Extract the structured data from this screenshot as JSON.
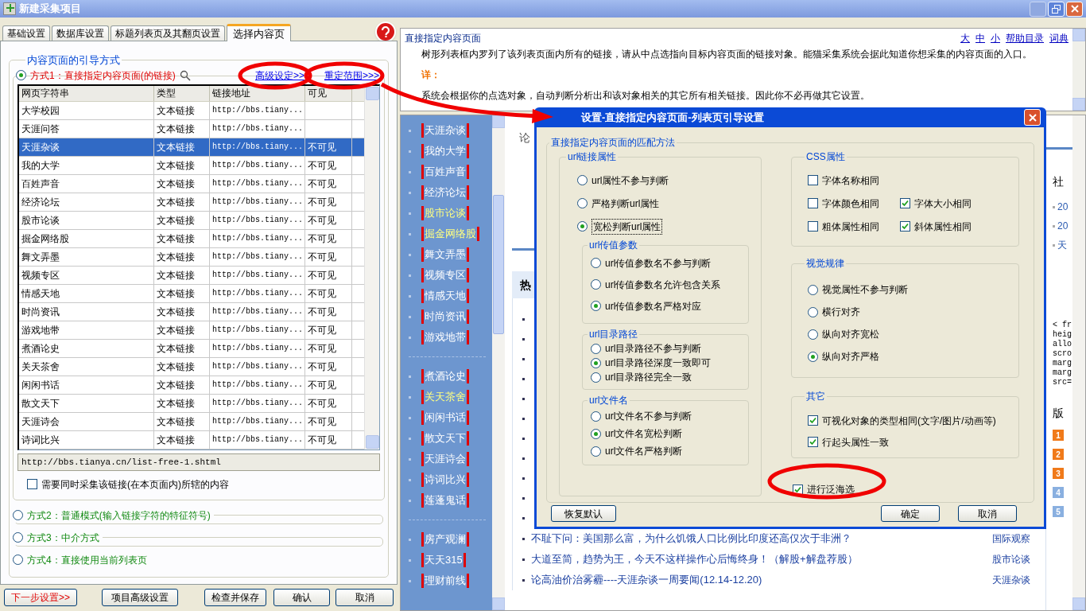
{
  "window": {
    "title": "新建采集项目"
  },
  "tabs": [
    {
      "label": "基础设置",
      "selected": false
    },
    {
      "label": "数据库设置",
      "selected": false
    },
    {
      "label": "标题列表页及其翻页设置",
      "selected": false
    },
    {
      "label": "选择内容页",
      "selected": true
    }
  ],
  "guide_group": {
    "title": "内容页面的引导方式",
    "links": [
      "高级设定>>",
      "重定范围>>>"
    ],
    "methods": [
      {
        "label": "方式1：直接指定内容页面(的链接)",
        "selected": true
      },
      {
        "label": "方式2：普通模式(输入链接字符的特征符号)",
        "selected": false
      },
      {
        "label": "方式3：中介方式",
        "selected": false
      },
      {
        "label": "方式4：直接使用当前列表页",
        "selected": false
      }
    ]
  },
  "table": {
    "columns": [
      "网页字符串",
      "类型",
      "链接地址",
      "可见"
    ],
    "rows": [
      {
        "text": "大学校园",
        "type": "文本链接",
        "url": "http://bbs.tiany...",
        "selected": false
      },
      {
        "text": "天涯问答",
        "type": "文本链接",
        "url": "http://bbs.tiany...",
        "selected": false
      },
      {
        "text": "天涯杂谈",
        "type": "文本链接",
        "url": "http://bbs.tiany...",
        "visible": "不可见",
        "selected": true
      },
      {
        "text": "我的大学",
        "type": "文本链接",
        "url": "http://bbs.tiany...",
        "visible": "不可见",
        "selected": false
      },
      {
        "text": "百姓声音",
        "type": "文本链接",
        "url": "http://bbs.tiany...",
        "visible": "不可见",
        "selected": false
      },
      {
        "text": "经济论坛",
        "type": "文本链接",
        "url": "http://bbs.tiany...",
        "visible": "不可见",
        "selected": false
      },
      {
        "text": "股市论谈",
        "type": "文本链接",
        "url": "http://bbs.tiany...",
        "visible": "不可见",
        "selected": false
      },
      {
        "text": "掘金网络股",
        "type": "文本链接",
        "url": "http://bbs.tiany...",
        "visible": "不可见",
        "selected": false
      },
      {
        "text": "舞文弄墨",
        "type": "文本链接",
        "url": "http://bbs.tiany...",
        "visible": "不可见",
        "selected": false
      },
      {
        "text": "视频专区",
        "type": "文本链接",
        "url": "http://bbs.tiany...",
        "visible": "不可见",
        "selected": false
      },
      {
        "text": "情感天地",
        "type": "文本链接",
        "url": "http://bbs.tiany...",
        "visible": "不可见",
        "selected": false
      },
      {
        "text": "时尚资讯",
        "type": "文本链接",
        "url": "http://bbs.tiany...",
        "visible": "不可见",
        "selected": false
      },
      {
        "text": "游戏地带",
        "type": "文本链接",
        "url": "http://bbs.tiany...",
        "visible": "不可见",
        "selected": false
      },
      {
        "text": "煮酒论史",
        "type": "文本链接",
        "url": "http://bbs.tiany...",
        "visible": "不可见",
        "selected": false
      },
      {
        "text": "关天茶舍",
        "type": "文本链接",
        "url": "http://bbs.tiany...",
        "visible": "不可见",
        "selected": false
      },
      {
        "text": "闲闲书话",
        "type": "文本链接",
        "url": "http://bbs.tiany...",
        "visible": "不可见",
        "selected": false
      },
      {
        "text": "散文天下",
        "type": "文本链接",
        "url": "http://bbs.tiany...",
        "visible": "不可见",
        "selected": false
      },
      {
        "text": "天涯诗会",
        "type": "文本链接",
        "url": "http://bbs.tiany...",
        "visible": "不可见",
        "selected": false
      },
      {
        "text": "诗词比兴",
        "type": "文本链接",
        "url": "http://bbs.tiany...",
        "visible": "不可见",
        "selected": false
      }
    ]
  },
  "url_field": {
    "value": "http://bbs.tianya.cn/list-free-1.shtml"
  },
  "collect_sub_content": {
    "label": "需要同时采集该链接(在本页面内)所辖的内容",
    "checked": false
  },
  "bottom_buttons": [
    {
      "label": "下一步设置>>",
      "kind": "next"
    },
    {
      "label": "项目高级设置",
      "kind": "normal"
    },
    {
      "label": "检查并保存",
      "kind": "normal"
    },
    {
      "label": "确认",
      "kind": "normal"
    },
    {
      "label": "取消",
      "kind": "normal"
    }
  ],
  "help": {
    "title": "直接指定内容页面",
    "links": [
      "大",
      "中",
      "小",
      "帮助目录",
      "词典"
    ],
    "paragraphs": [
      {
        "kind": "body",
        "text": "树形列表框内罗列了该列表页面内所有的链接，请从中点选指向目标内容页面的链接对象。能猫采集系统会据此知道你想采集的内容页面的入口。"
      },
      {
        "kind": "heading",
        "text": "详："
      },
      {
        "kind": "body",
        "text": "系统会根据你的点选对象，自动判断分析出和该对象相关的其它所有相关链接。因此你不必再做其它设置。"
      }
    ]
  },
  "browser": {
    "sidebar_groups": [
      {
        "items": [
          {
            "label": "天涯杂谈",
            "highlighted": false
          },
          {
            "label": "我的大学",
            "highlighted": false
          },
          {
            "label": "百姓声音",
            "highlighted": false
          },
          {
            "label": "经济论坛",
            "highlighted": false
          },
          {
            "label": "股市论谈",
            "highlighted": true
          },
          {
            "label": "掘金网络股",
            "highlighted": true
          },
          {
            "label": "舞文弄墨",
            "highlighted": false
          },
          {
            "label": "视频专区",
            "highlighted": false
          },
          {
            "label": "情感天地",
            "highlighted": false
          },
          {
            "label": "时尚资讯",
            "highlighted": false
          },
          {
            "label": "游戏地带",
            "highlighted": false
          }
        ]
      },
      {
        "items": [
          {
            "label": "煮酒论史",
            "highlighted": false
          },
          {
            "label": "关天茶舍",
            "highlighted": true
          },
          {
            "label": "闲闲书话",
            "highlighted": false
          },
          {
            "label": "散文天下",
            "highlighted": false
          },
          {
            "label": "天涯诗会",
            "highlighted": false
          },
          {
            "label": "诗词比兴",
            "highlighted": false
          },
          {
            "label": "莲蓬鬼话",
            "highlighted": false
          }
        ]
      },
      {
        "items": [
          {
            "label": "房产观澜",
            "highlighted": false
          },
          {
            "label": "天天315",
            "highlighted": false
          },
          {
            "label": "理财前线",
            "highlighted": false
          }
        ]
      }
    ],
    "top_heading": "论",
    "section_heading": "热",
    "news": [
      {
        "title": "不耻下问：美国那么富，为什么饥饿人口比例比印度还高仅次于非洲？",
        "section": "国际观察"
      },
      {
        "title": "大道至简，趋势为王，今天不这样操作心后悔终身！（解股+解盘荐股）",
        "section": "股市论谈"
      },
      {
        "title": "论高油价治雾霾----天涯杂谈一周要闻(12.14-12.20)",
        "section": "天涯杂谈"
      }
    ],
    "right_column": {
      "heading": "社",
      "items": [
        "20",
        "20",
        "天"
      ],
      "code_lines": [
        "< fr",
        "heig",
        "allo",
        "scro",
        "marg",
        "marg",
        "src="
      ],
      "board_heading": "版",
      "ranks": [
        {
          "label": "1",
          "hot": true
        },
        {
          "label": "2",
          "hot": true
        },
        {
          "label": "3",
          "hot": true
        },
        {
          "label": "4",
          "hot": false
        },
        {
          "label": "5",
          "hot": false
        }
      ]
    }
  },
  "dialog": {
    "title": "设置-直接指定内容页面-列表页引导设置",
    "group_title": "直接指定内容页面的匹配方法",
    "url_group": {
      "title": "url链接属性",
      "options": [
        {
          "label": "url属性不参与判断",
          "selected": false
        },
        {
          "label": "严格判断url属性",
          "selected": false
        },
        {
          "label": "宽松判断url属性",
          "selected": true
        }
      ],
      "subgroups": [
        {
          "title": "url传值参数",
          "options": [
            {
              "label": "url传值参数名不参与判断",
              "selected": false
            },
            {
              "label": "url传值参数名允许包含关系",
              "selected": false
            },
            {
              "label": "url传值参数名严格对应",
              "selected": true
            }
          ]
        },
        {
          "title": "url目录路径",
          "options": [
            {
              "label": "url目录路径不参与判断",
              "selected": false
            },
            {
              "label": "url目录路径深度一致即可",
              "selected": true
            },
            {
              "label": "url目录路径完全一致",
              "selected": false
            }
          ]
        },
        {
          "title": "url文件名",
          "options": [
            {
              "label": "url文件名不参与判断",
              "selected": false
            },
            {
              "label": "url文件名宽松判断",
              "selected": true
            },
            {
              "label": "url文件名严格判断",
              "selected": false
            }
          ]
        }
      ]
    },
    "css_group": {
      "title": "CSS属性",
      "rows": [
        [
          {
            "label": "字体名称相同",
            "checked": false
          }
        ],
        [
          {
            "label": "字体颜色相同",
            "checked": false
          },
          {
            "label": "字体大小相同",
            "checked": true
          }
        ],
        [
          {
            "label": "粗体属性相同",
            "checked": false
          },
          {
            "label": "斜体属性相同",
            "checked": true
          }
        ]
      ]
    },
    "visual_group": {
      "title": "视觉规律",
      "options": [
        {
          "label": "视觉属性不参与判断",
          "selected": false
        },
        {
          "label": "横行对齐",
          "selected": false
        },
        {
          "label": "纵向对齐宽松",
          "selected": false
        },
        {
          "label": "纵向对齐严格",
          "selected": true
        }
      ]
    },
    "other_group": {
      "title": "其它",
      "options": [
        {
          "label": "可视化对象的类型相同(文字/图片/动画等)",
          "checked": true
        },
        {
          "label": "行起头属性一致",
          "checked": true
        }
      ]
    },
    "wide_filter": {
      "label": "进行泛海选",
      "checked": true
    },
    "buttons": [
      "恢复默认",
      "确定",
      "取消"
    ]
  }
}
